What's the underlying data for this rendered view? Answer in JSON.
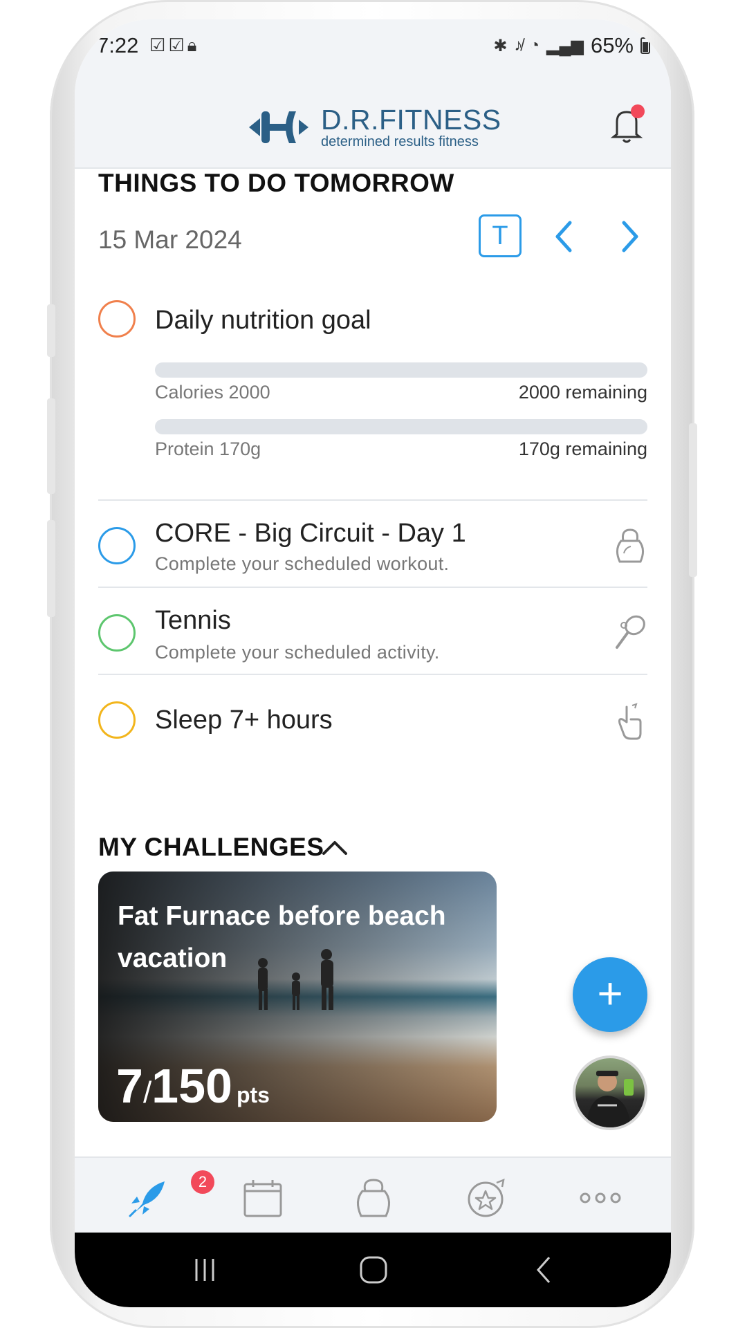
{
  "status_bar": {
    "time": "7:22",
    "left_icons": [
      "check-circle-icon",
      "check-circle-icon",
      "lock-icon"
    ],
    "battery": "65%",
    "right_icons": [
      "bluetooth-icon",
      "mute-icon",
      "wifi-icon",
      "signal-icon",
      "battery-icon"
    ]
  },
  "header": {
    "logo_title": "D.R.FITNESS",
    "logo_subtitle": "determined results fitness",
    "notification_dot_color": "#f2495a"
  },
  "todo": {
    "section_title": "THINGS TO DO TOMORROW",
    "date": "15 Mar 2024",
    "today_button": "T",
    "items": [
      {
        "title": "Daily nutrition goal",
        "color": "#f0804c",
        "bars": [
          {
            "label": "Calories 2000",
            "remaining": "2000 remaining",
            "progress": 0
          },
          {
            "label": "Protein 170g",
            "remaining": "170g remaining",
            "progress": 0
          }
        ]
      },
      {
        "title": "CORE - Big Circuit - Day 1",
        "subtitle": "Complete your scheduled workout.",
        "color": "#2b9be8",
        "icon": "kettlebell-icon"
      },
      {
        "title": "Tennis",
        "subtitle": "Complete your scheduled activity.",
        "color": "#5dc66e",
        "icon": "tennis-racket-icon"
      },
      {
        "title": "Sleep 7+ hours",
        "color": "#f2b51c",
        "icon": "hand-icon"
      }
    ]
  },
  "challenges": {
    "section_title": "MY CHALLENGES",
    "card": {
      "name": "Fat Furnace before beach vacation",
      "points": "7",
      "slash": "/",
      "total": "150",
      "unit": "pts"
    },
    "fab_label": "+"
  },
  "tabbar": {
    "badge_count": "2",
    "accent_color": "#2b9be8",
    "tabs": [
      "rocket-icon",
      "calendar-icon",
      "kettlebell-icon",
      "star-badge-icon",
      "more-icon"
    ]
  }
}
